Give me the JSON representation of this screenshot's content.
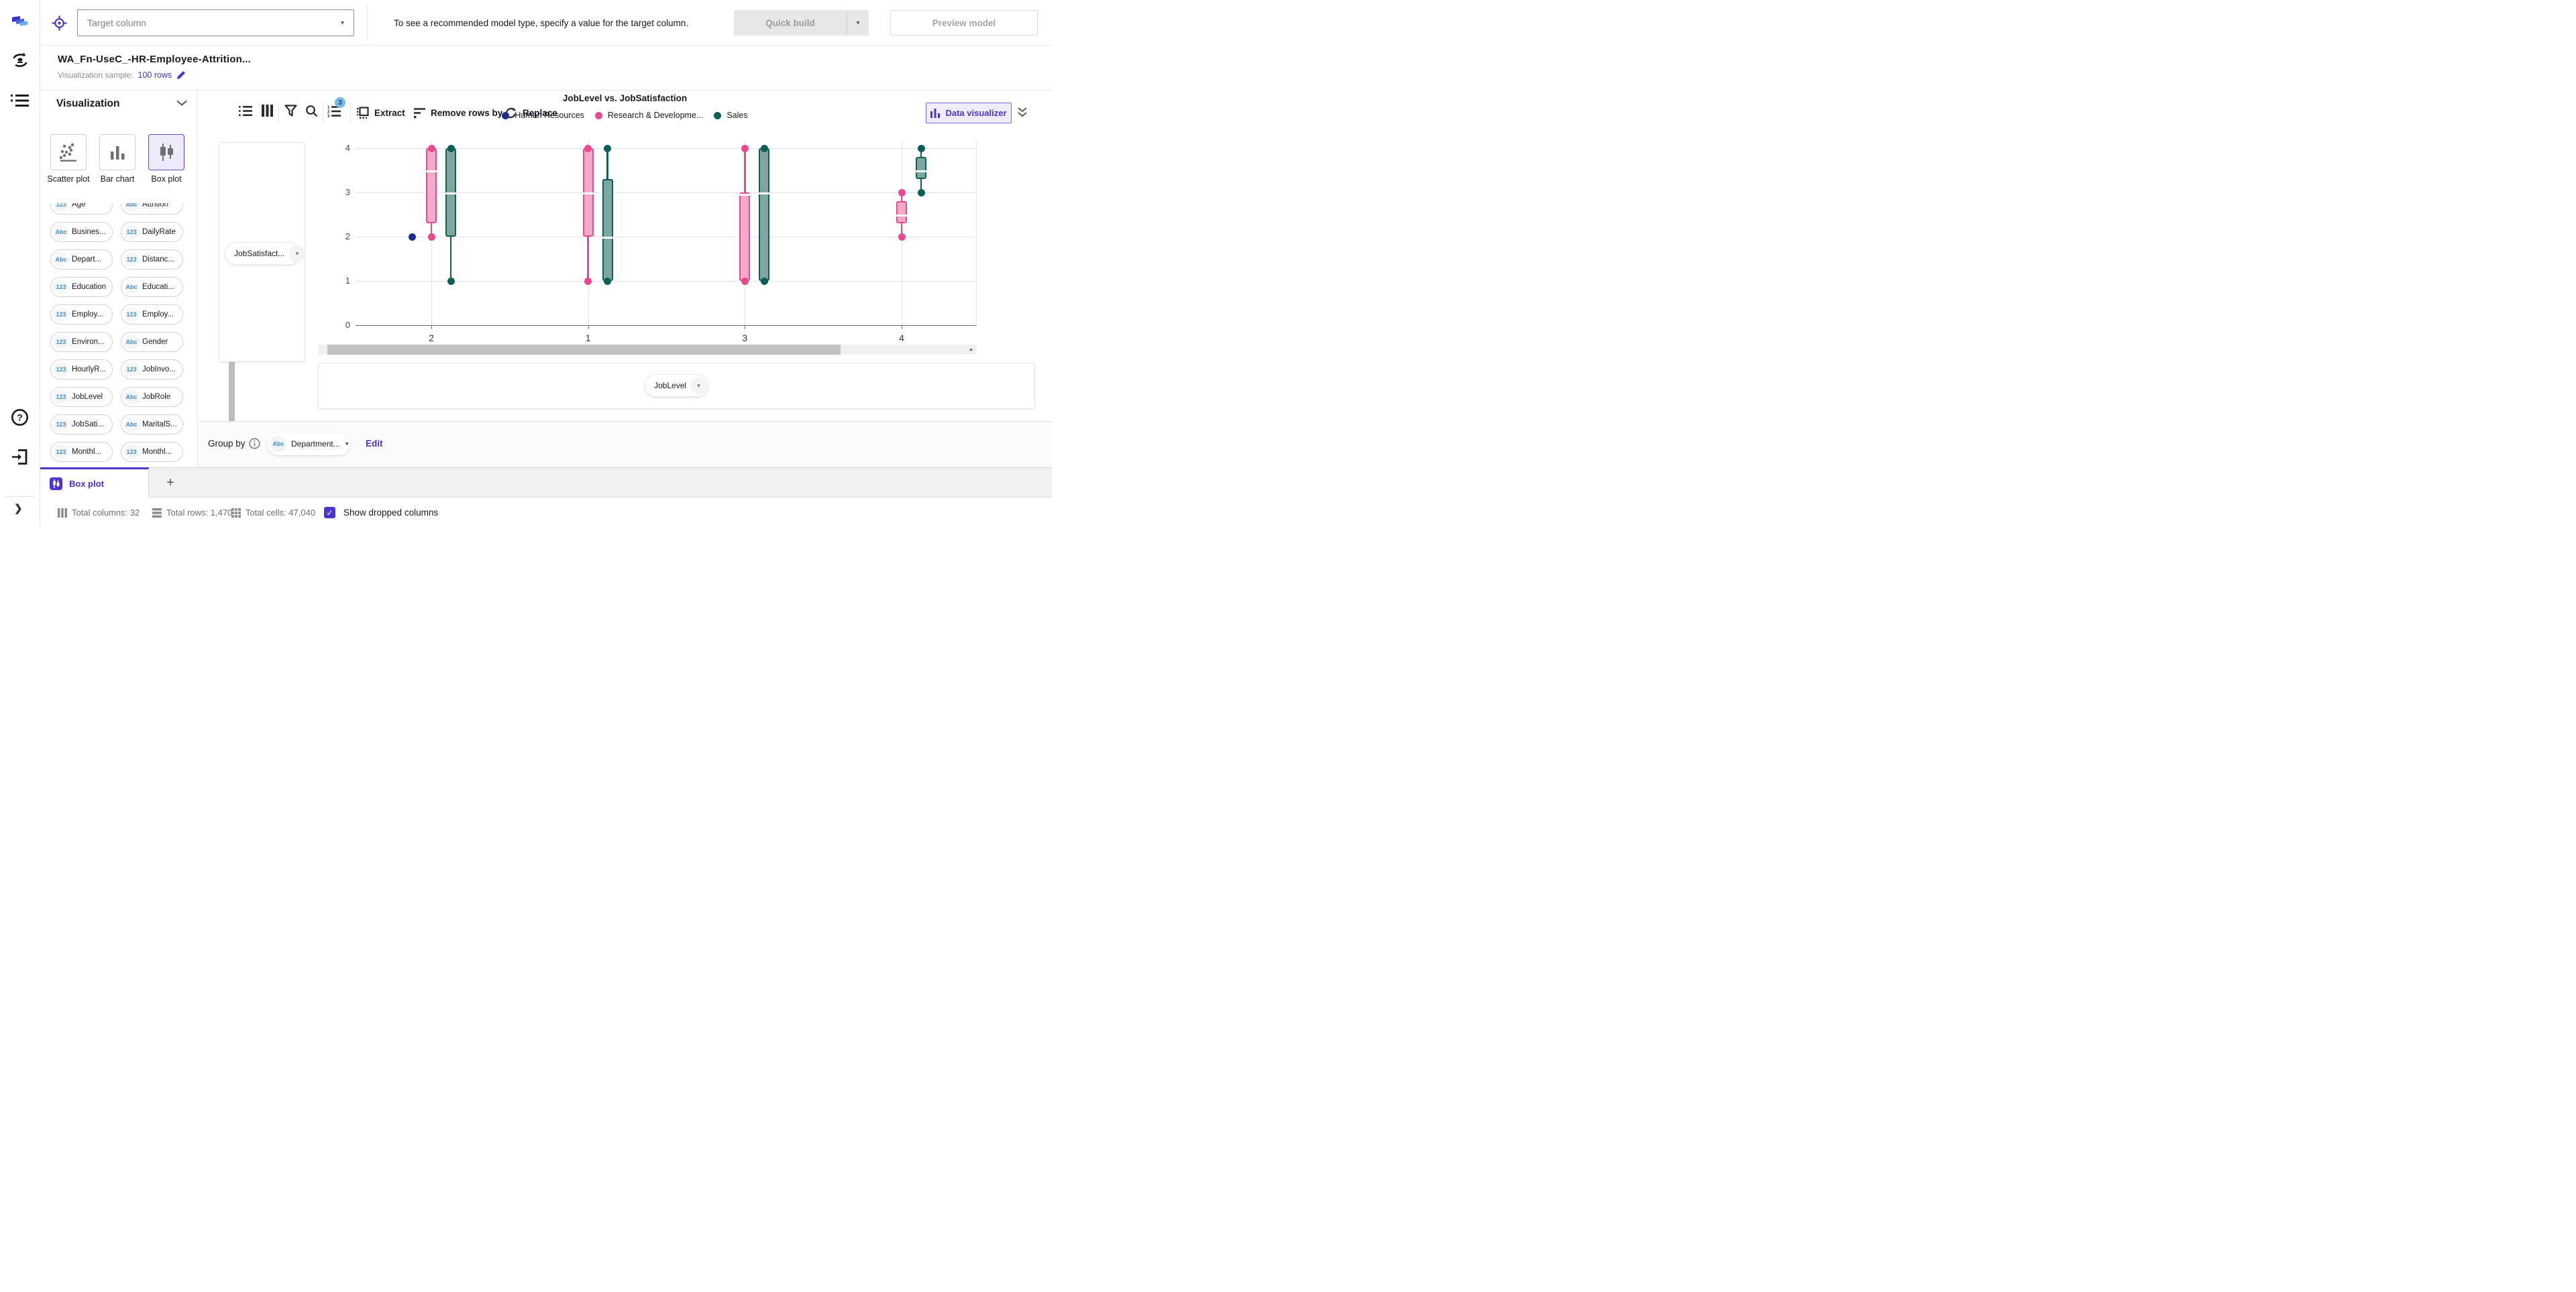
{
  "topbar": {
    "target_select": {
      "placeholder": "Target column"
    },
    "message": "To see a recommended model type, specify a value for the target column.",
    "quick_build": "Quick build",
    "preview_model": "Preview model"
  },
  "toolbar": {
    "dataset_title": "WA_Fn-UseC_-HR-Employee-Attrition...",
    "sample_label": "Visualization sample:",
    "sample_value": "100 rows",
    "steps_badge": "3",
    "extract": "Extract",
    "remove_rows": "Remove rows by",
    "replace": "Replace",
    "data_visualizer": "Data visualizer"
  },
  "viz_panel": {
    "title": "Visualization",
    "chart_types": [
      {
        "label": "Scatter plot",
        "selected": false
      },
      {
        "label": "Bar chart",
        "selected": false
      },
      {
        "label": "Box plot",
        "selected": true
      }
    ]
  },
  "columns": [
    {
      "type": "123",
      "label": "Age"
    },
    {
      "type": "Abc",
      "label": "Attrition"
    },
    {
      "type": "Abc",
      "label": "Busines..."
    },
    {
      "type": "123",
      "label": "DailyRate"
    },
    {
      "type": "Abc",
      "label": "Depart..."
    },
    {
      "type": "123",
      "label": "Distanc..."
    },
    {
      "type": "123",
      "label": "Education"
    },
    {
      "type": "Abc",
      "label": "Educati..."
    },
    {
      "type": "123",
      "label": "Employ..."
    },
    {
      "type": "123",
      "label": "Employ..."
    },
    {
      "type": "123",
      "label": "Environ..."
    },
    {
      "type": "Abc",
      "label": "Gender"
    },
    {
      "type": "123",
      "label": "HourlyR..."
    },
    {
      "type": "123",
      "label": "JobInvo..."
    },
    {
      "type": "123",
      "label": "JobLevel"
    },
    {
      "type": "Abc",
      "label": "JobRole"
    },
    {
      "type": "123",
      "label": "JobSati..."
    },
    {
      "type": "Abc",
      "label": "MaritalS..."
    },
    {
      "type": "123",
      "label": "Monthl..."
    },
    {
      "type": "123",
      "label": "Monthl..."
    }
  ],
  "y_dropzone": "JobSatisfact...",
  "x_dropzone": "JobLevel",
  "group_by": {
    "label": "Group by",
    "value_type": "Abc",
    "value": "Department...",
    "edit": "Edit"
  },
  "tabs": {
    "active": "Box plot",
    "add": "+"
  },
  "status": {
    "total_columns": "Total columns: 32",
    "total_rows": "Total rows: 1,470",
    "total_cells": "Total cells: 47,040",
    "show_dropped": "Show dropped columns",
    "show_dropped_checked": true
  },
  "icons": {
    "caret_down": "▾",
    "arrow_up": "▲",
    "arrow_down": "▼",
    "arrow_left": "◂",
    "arrow_right": "▸",
    "chevron_right": "❯",
    "check": "✓",
    "plus": "+"
  },
  "chart_data": {
    "type": "box",
    "title": "JobLevel vs. JobSatisfaction",
    "xlabel_field": "JobLevel",
    "ylabel_field": "JobSatisfaction",
    "x_categories": [
      "2",
      "1",
      "3",
      "4"
    ],
    "y_ticks": [
      0,
      1,
      2,
      3,
      4
    ],
    "ylim": [
      0,
      4
    ],
    "grid": true,
    "legend_position": "top",
    "series": [
      {
        "name": "Human Resources",
        "color": "#1b2d8f",
        "fill": "#1b2d8f",
        "boxes": [
          {
            "category": "2",
            "point": 2
          }
        ]
      },
      {
        "name": "Research & Developme...",
        "color": "#e8498f",
        "fill": "#f3a9c9",
        "boxes": [
          {
            "category": "2",
            "q1": 2.3,
            "median": 3.5,
            "q3": 4,
            "whisker_low": 2,
            "whisker_high": 4
          },
          {
            "category": "1",
            "q1": 2,
            "median": 3,
            "q3": 4,
            "whisker_low": 1,
            "whisker_high": 4
          },
          {
            "category": "3",
            "q1": 1,
            "median": 3,
            "q3": 3,
            "whisker_low": 1,
            "whisker_high": 4
          },
          {
            "category": "4",
            "q1": 2.3,
            "median": 2.5,
            "q3": 2.8,
            "whisker_low": 2,
            "whisker_high": 3
          }
        ]
      },
      {
        "name": "Sales",
        "color": "#0e5e59",
        "fill": "#7fa7a1",
        "boxes": [
          {
            "category": "2",
            "q1": 2,
            "median": 3,
            "q3": 4,
            "whisker_low": 1,
            "whisker_high": 4
          },
          {
            "category": "1",
            "q1": 1,
            "median": 2,
            "q3": 3.3,
            "whisker_low": 1,
            "whisker_high": 4
          },
          {
            "category": "3",
            "q1": 1,
            "median": 3,
            "q3": 4,
            "whisker_low": 1,
            "whisker_high": 4
          },
          {
            "category": "4",
            "q1": 3.3,
            "median": 3.5,
            "q3": 3.8,
            "whisker_low": 3,
            "whisker_high": 4
          }
        ]
      }
    ]
  }
}
